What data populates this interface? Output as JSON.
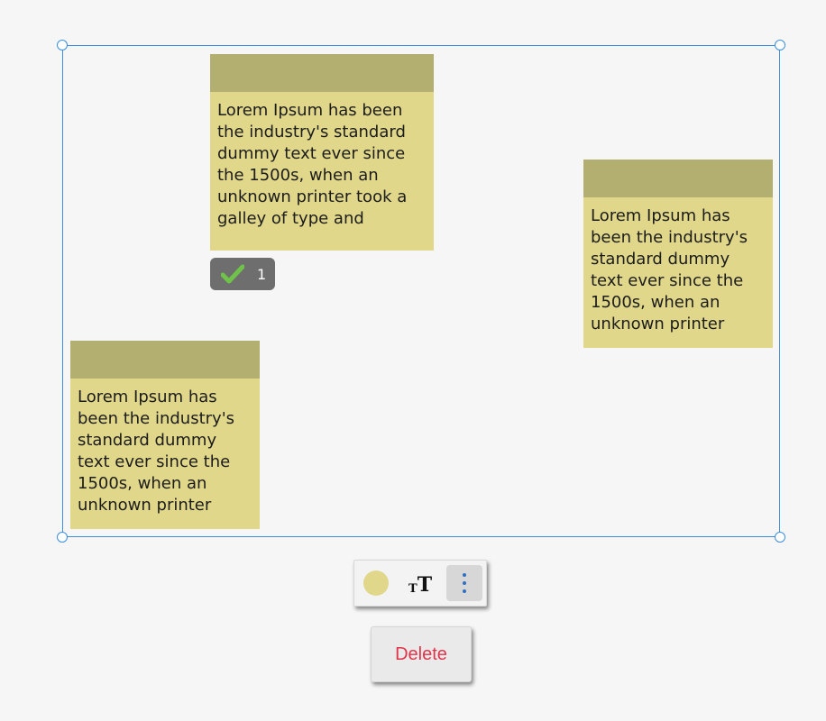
{
  "notes": [
    {
      "text": "Lorem Ipsum has been the industry's standard dummy text ever since the 1500s, when an unknown printer took a galley of type and"
    },
    {
      "text": "Lorem Ipsum has been the industry's standard dummy text ever since the 1500s, when an unknown printer"
    },
    {
      "text": "Lorem Ipsum has been the industry's standard dummy text ever since the 1500s, when an unknown printer"
    }
  ],
  "badge": {
    "count": "1",
    "icon": "check-icon"
  },
  "toolbar": {
    "color_swatch": "#e0d78a",
    "text_size_small": "T",
    "text_size_big": "T",
    "more_icon": "more-vertical-icon"
  },
  "delete": {
    "label": "Delete"
  },
  "colors": {
    "note_body": "#e0d78a",
    "note_header": "#b3af70",
    "selection": "#3b8ee0",
    "delete_text": "#e0344a"
  }
}
